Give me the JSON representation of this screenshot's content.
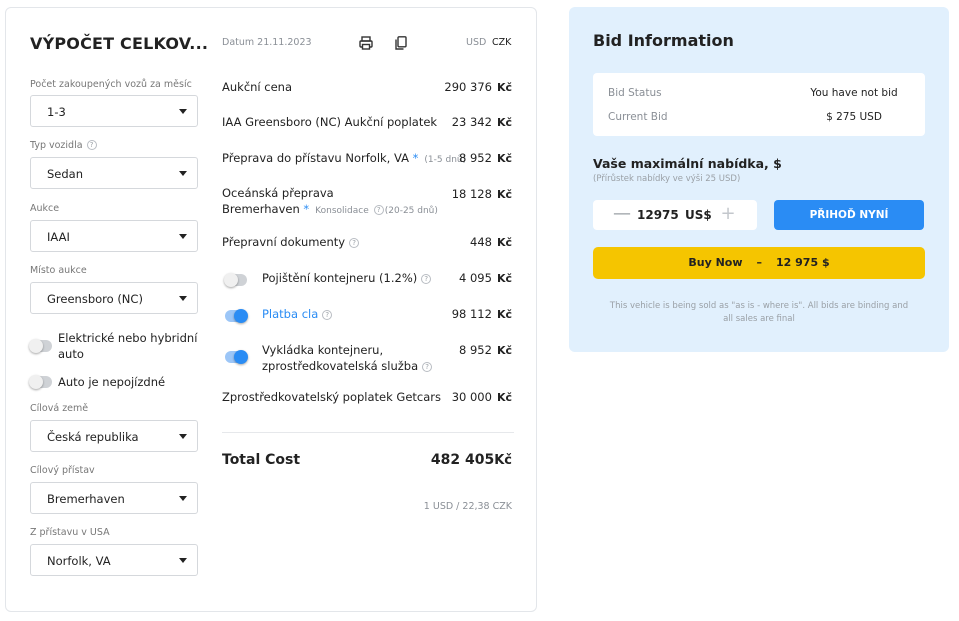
{
  "calculator": {
    "title": "VÝPOČET CELKOV...",
    "date": "Datum 21.11.2023",
    "currency_usd": "USD",
    "currency_czk": "CZK",
    "fields": {
      "cars_per_month": {
        "label": "Počet zakoupených vozů za měsíc",
        "value": "1-3"
      },
      "vehicle_type": {
        "label": "Typ vozidla",
        "value": "Sedan"
      },
      "auction": {
        "label": "Aukce",
        "value": "IAAI"
      },
      "auction_location": {
        "label": "Místo aukce",
        "value": "Greensboro (NC)"
      },
      "electric_toggle": {
        "label": "Elektrické nebo hybridní auto",
        "on": false
      },
      "not_driveable_toggle": {
        "label": "Auto je nepojízdné",
        "on": false
      },
      "destination_country": {
        "label": "Cílová země",
        "value": "Česká republika"
      },
      "destination_port": {
        "label": "Cílový přístav",
        "value": "Bremerhaven"
      },
      "usa_port": {
        "label": "Z přístavu v USA",
        "value": "Norfolk, VA"
      }
    },
    "costs": {
      "auction_price": {
        "label": "Aukční cena",
        "value": "290 376"
      },
      "auction_fee": {
        "label": "IAA Greensboro (NC) Aukční poplatek",
        "value": "23 342"
      },
      "port_transport": {
        "label": "Přeprava do přístavu Norfolk, VA",
        "star": "*",
        "note": "(1-5 dnů)",
        "value": "8 952"
      },
      "ocean": {
        "label1": "Oceánská přeprava",
        "label2": "Bremerhaven",
        "star": "*",
        "consolidation": "Konsolidace",
        "note": "(20-25 dnů)",
        "value": "18 128"
      },
      "documents": {
        "label": "Přepravní dokumenty",
        "value": "448"
      },
      "insurance": {
        "label": "Pojištění kontejneru (1.2%)",
        "value": "4 095",
        "on": false
      },
      "customs": {
        "label": "Platba cla",
        "value": "98 112",
        "on": true
      },
      "unloading": {
        "label1": "Vykládka kontejneru,",
        "label2": "zprostředkovatelská služba",
        "value": "8 952",
        "on": true
      },
      "getcars_fee": {
        "label": "Zprostředkovatelský poplatek Getcars",
        "value": "30 000"
      }
    },
    "currency_symbol": "Kč",
    "total_label": "Total Cost",
    "total_value": "482 405",
    "exchange_rate": "1 USD / 22,38 CZK"
  },
  "bid": {
    "title": "Bid Information",
    "status_label": "Bid Status",
    "status_value": "You have not bid",
    "current_label": "Current Bid",
    "current_value": "$ 275 USD",
    "max_title": "Vaše maximální nabídka, $",
    "max_subtitle": "(Přírůstek nabídky ve výši 25 USD)",
    "amount": "12975",
    "amount_unit": "US$",
    "minus": "—",
    "plus": "+",
    "bid_button": "PŘIHOĎ NYNÍ",
    "buy_now_label": "Buy Now",
    "buy_now_sep": "–",
    "buy_now_price": "12 975 $",
    "disclaimer": "This vehicle is being sold as \"as is - where is\". All bids are binding and all sales are final"
  },
  "icons": {
    "help": "?"
  },
  "colors": {
    "accent_blue": "#2a8cf4",
    "bid_panel_bg": "#e1f0fd",
    "buy_now_yellow": "#f5c500"
  }
}
